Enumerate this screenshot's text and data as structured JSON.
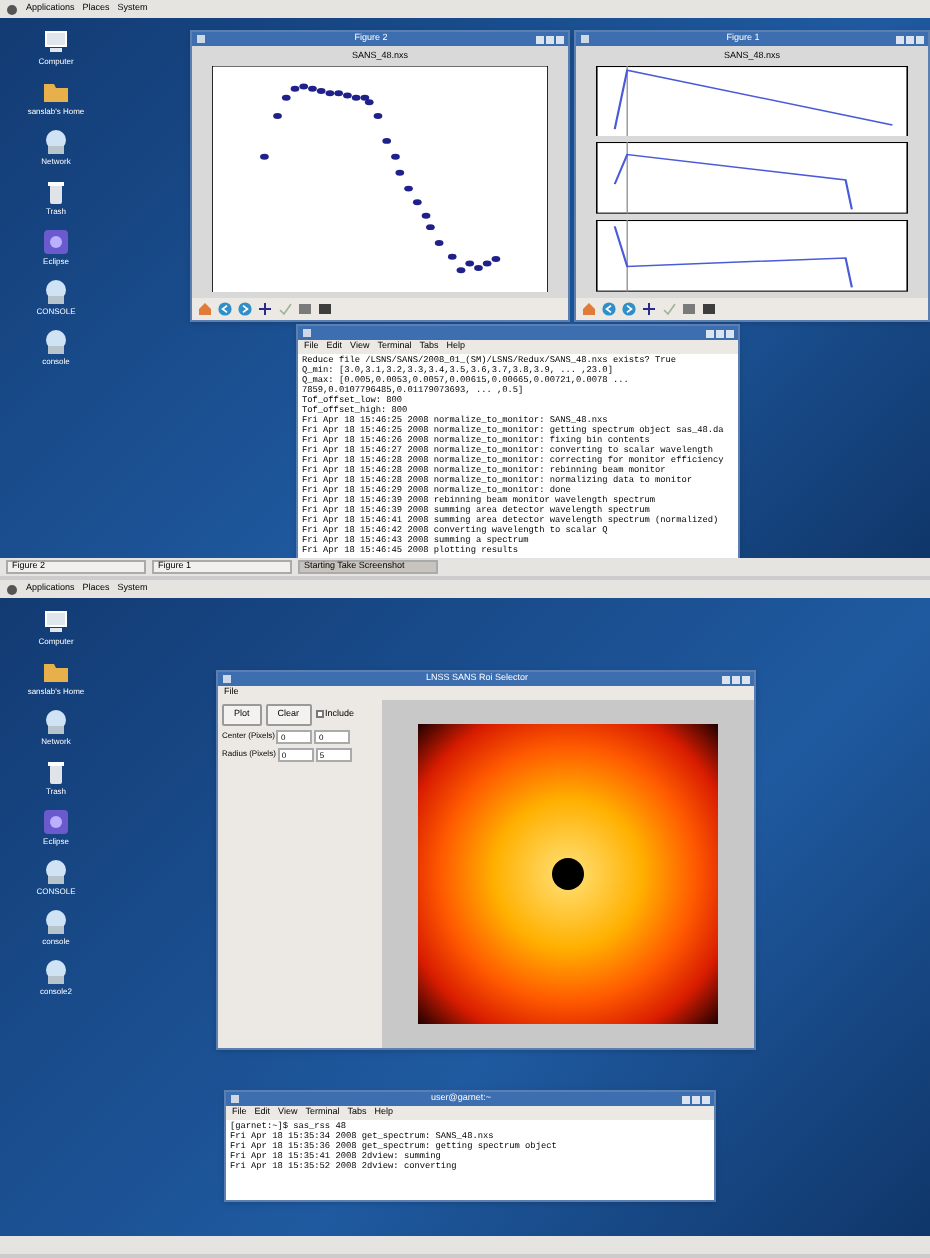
{
  "screens": [
    {
      "top_panel": {
        "menus": [
          "Applications",
          "Places",
          "System"
        ]
      },
      "desktop_icons": [
        {
          "label": "Computer",
          "kind": "computer"
        },
        {
          "label": "sanslab's Home",
          "kind": "folder"
        },
        {
          "label": "Network",
          "kind": "globe"
        },
        {
          "label": "Trash",
          "kind": "trash"
        },
        {
          "label": "Eclipse",
          "kind": "app"
        },
        {
          "label": "CONSOLE",
          "kind": "globe"
        },
        {
          "label": "console",
          "kind": "globe"
        }
      ],
      "windows": [
        {
          "kind": "scatter_figure",
          "title": "Figure 2",
          "plot_title": "SANS_48.nxs"
        },
        {
          "kind": "stacked_figure",
          "title": "Figure 1",
          "plot_title": "SANS_48.nxs"
        },
        {
          "kind": "terminal",
          "menus": [
            "File",
            "Edit",
            "View",
            "Terminal",
            "Tabs",
            "Help"
          ],
          "lines": [
            "Reduce file /LSNS/SANS/2008_01_(SM)/LSNS/Redux/SANS_48.nxs exists? True",
            "  Q_min: [3.0,3.1,3.2,3.3,3.4,3.5,3.6,3.7,3.8,3.9, ... ,23.0]",
            "  Q_max: [0.005,0.0053,0.0057,0.00615,0.00665,0.00721,0.0078 ...",
            "7859,0.0107796485,0.01179073693, ... ,0.5]",
            "Tof_offset_low: 800",
            "Tof_offset_high: 800",
            "Fri Apr 18 15:46:25 2008 normalize_to_monitor: SANS_48.nxs",
            "Fri Apr 18 15:46:25 2008 normalize_to_monitor: getting spectrum object sas_48.da",
            "Fri Apr 18 15:46:26 2008 normalize_to_monitor: fixing bin contents",
            "Fri Apr 18 15:46:27 2008 normalize_to_monitor: converting to scalar wavelength",
            "Fri Apr 18 15:46:28 2008 normalize_to_monitor: correcting for monitor efficiency",
            "Fri Apr 18 15:46:28 2008 normalize_to_monitor: rebinning beam monitor",
            "Fri Apr 18 15:46:28 2008 normalize_to_monitor: normalizing data to monitor",
            "Fri Apr 18 15:46:29 2008 normalize_to_monitor: done",
            "Fri Apr 18 15:46:39 2008 rebinning beam monitor wavelength spectrum",
            "Fri Apr 18 15:46:39 2008 summing area detector wavelength spectrum",
            "Fri Apr 18 15:46:41 2008 summing area detector wavelength spectrum (normalized)",
            "Fri Apr 18 15:46:42 2008 converting wavelength to scalar Q",
            "Fri Apr 18 15:46:43 2008 summing a spectrum",
            "Fri Apr 18 15:46:45 2008 plotting results"
          ]
        }
      ],
      "taskbar": [
        {
          "label": "Figure 2",
          "selected": false
        },
        {
          "label": "Figure 1",
          "selected": false
        },
        {
          "label": "Starting Take Screenshot",
          "selected": true
        }
      ]
    },
    {
      "top_panel": {
        "menus": [
          "Applications",
          "Places",
          "System"
        ]
      },
      "desktop_icons": [
        {
          "label": "Computer",
          "kind": "computer"
        },
        {
          "label": "sanslab's Home",
          "kind": "folder"
        },
        {
          "label": "Network",
          "kind": "globe"
        },
        {
          "label": "Trash",
          "kind": "trash"
        },
        {
          "label": "Eclipse",
          "kind": "app"
        },
        {
          "label": "CONSOLE",
          "kind": "globe"
        },
        {
          "label": "console",
          "kind": "globe"
        },
        {
          "label": "console2",
          "kind": "globe"
        }
      ],
      "windows": [
        {
          "kind": "roi",
          "title": "LNSS SANS Roi Selector",
          "menus": [
            "File"
          ],
          "buttons": [
            "Plot",
            "Clear"
          ],
          "include": {
            "label": "Include",
            "checked": false
          },
          "fields": [
            {
              "label": "Center (Pixels)",
              "values": [
                "0",
                "0"
              ]
            },
            {
              "label": "Radius (Pixels)",
              "values": [
                "0",
                "5"
              ]
            }
          ]
        },
        {
          "kind": "terminal",
          "title": "user@garnet:~",
          "menus": [
            "File",
            "Edit",
            "View",
            "Terminal",
            "Tabs",
            "Help"
          ],
          "lines": [
            "[garnet:~]$ sas_rss 48",
            "Fri Apr 18 15:35:34 2008 get_spectrum: SANS_48.nxs",
            "Fri Apr 18 15:35:36 2008 get_spectrum: getting spectrum object",
            "Fri Apr 18 15:35:41 2008 2dview: summing",
            "Fri Apr 18 15:35:52 2008 2dview: converting"
          ]
        }
      ]
    }
  ]
}
